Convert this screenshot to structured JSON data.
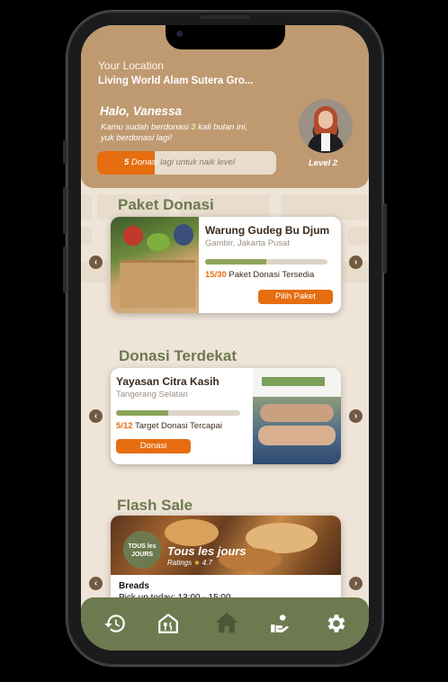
{
  "location": {
    "label": "Your Location",
    "value": "Living World Alam Sutera Gro..."
  },
  "greeting": {
    "hello": "Halo, Vanessa",
    "line1_a": "Kamu sudah berdonasi ",
    "count": "3",
    "line1_b": " kali bulan ini,",
    "line2": "yuk berdonasi lagi!",
    "progress_num": "5",
    "progress_text": " Donasi",
    "progress_rest": " lagi untuk naik level",
    "progress_fraction": 0.32,
    "level": "Level 2"
  },
  "paket": {
    "section_title": "Paket Donasi",
    "title": "Warung Gudeg Bu Djum",
    "subtitle": "Gambir, Jakarta Pusat",
    "progress_fraction": 0.5,
    "count": "15/30",
    "count_text": " Paket Donasi Tersedia",
    "button": "Pilih Paket"
  },
  "terdekat": {
    "section_title": "Donasi Terdekat",
    "title": "Yayasan Citra Kasih",
    "subtitle": "Tangerang Selatan",
    "progress_fraction": 0.42,
    "count": "5/12",
    "count_text": " Target Donasi Tercapai",
    "button": "Donasi"
  },
  "flash": {
    "section_title": "Flash Sale",
    "logo_text_1": "TOUS les",
    "logo_text_2": "JOURS",
    "brand": "Tous les jours",
    "ratings_label": "Ratings",
    "rating": "4.7",
    "item": "Breads",
    "pickup": "Pick up today: 13:00 - 15:00"
  },
  "colors": {
    "brand_olive": "#6d7a4f",
    "header_tan": "#bf9a71",
    "accent_orange": "#e66d10",
    "background": "#efe4d8"
  },
  "nav": {
    "icons": [
      "history-icon",
      "restaurant-icon",
      "home-icon",
      "donate-hand-icon",
      "settings-icon"
    ]
  }
}
